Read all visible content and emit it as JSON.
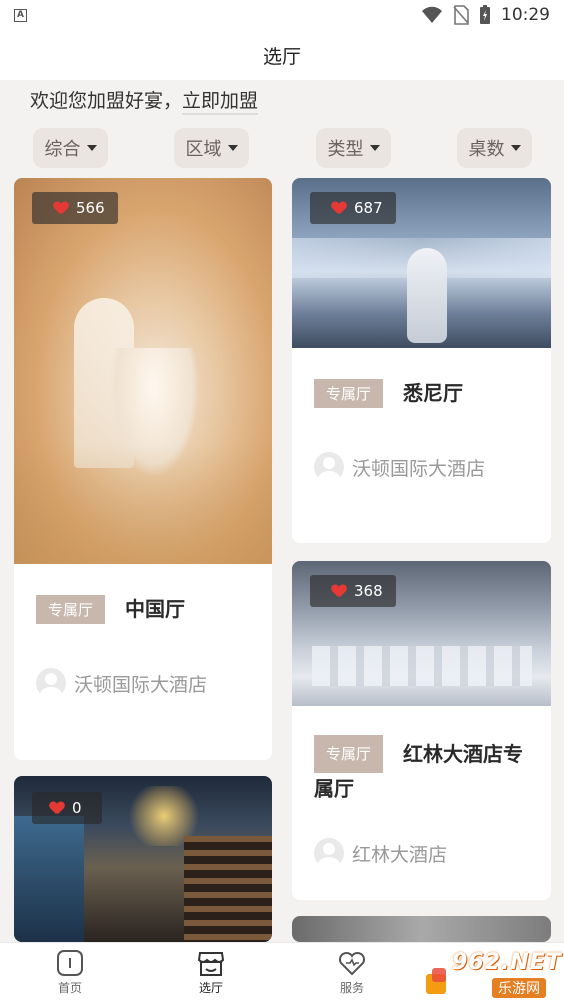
{
  "status_bar": {
    "time": "10:29",
    "left_icon": "A"
  },
  "header": {
    "title": "选厅"
  },
  "welcome": {
    "text": "欢迎您加盟好宴，",
    "link": "立即加盟"
  },
  "filters": [
    {
      "label": "综合"
    },
    {
      "label": "区域"
    },
    {
      "label": "类型"
    },
    {
      "label": "桌数"
    }
  ],
  "cards": [
    {
      "likes": "566",
      "tag": "专属厅",
      "hall": "中国厅",
      "hotel": "沃顿国际大酒店"
    },
    {
      "likes": "687",
      "tag": "专属厅",
      "hall": "悉尼厅",
      "hotel": "沃顿国际大酒店"
    },
    {
      "likes": "368",
      "tag": "专属厅",
      "hall": "红林大酒店专属厅",
      "hotel": "红林大酒店"
    },
    {
      "likes": "0"
    }
  ],
  "tabbar": {
    "items": [
      {
        "label": "首页"
      },
      {
        "label": "选厅"
      },
      {
        "label": "服务"
      }
    ]
  },
  "watermark": {
    "brand": "962.NET",
    "sub": "乐游网"
  }
}
